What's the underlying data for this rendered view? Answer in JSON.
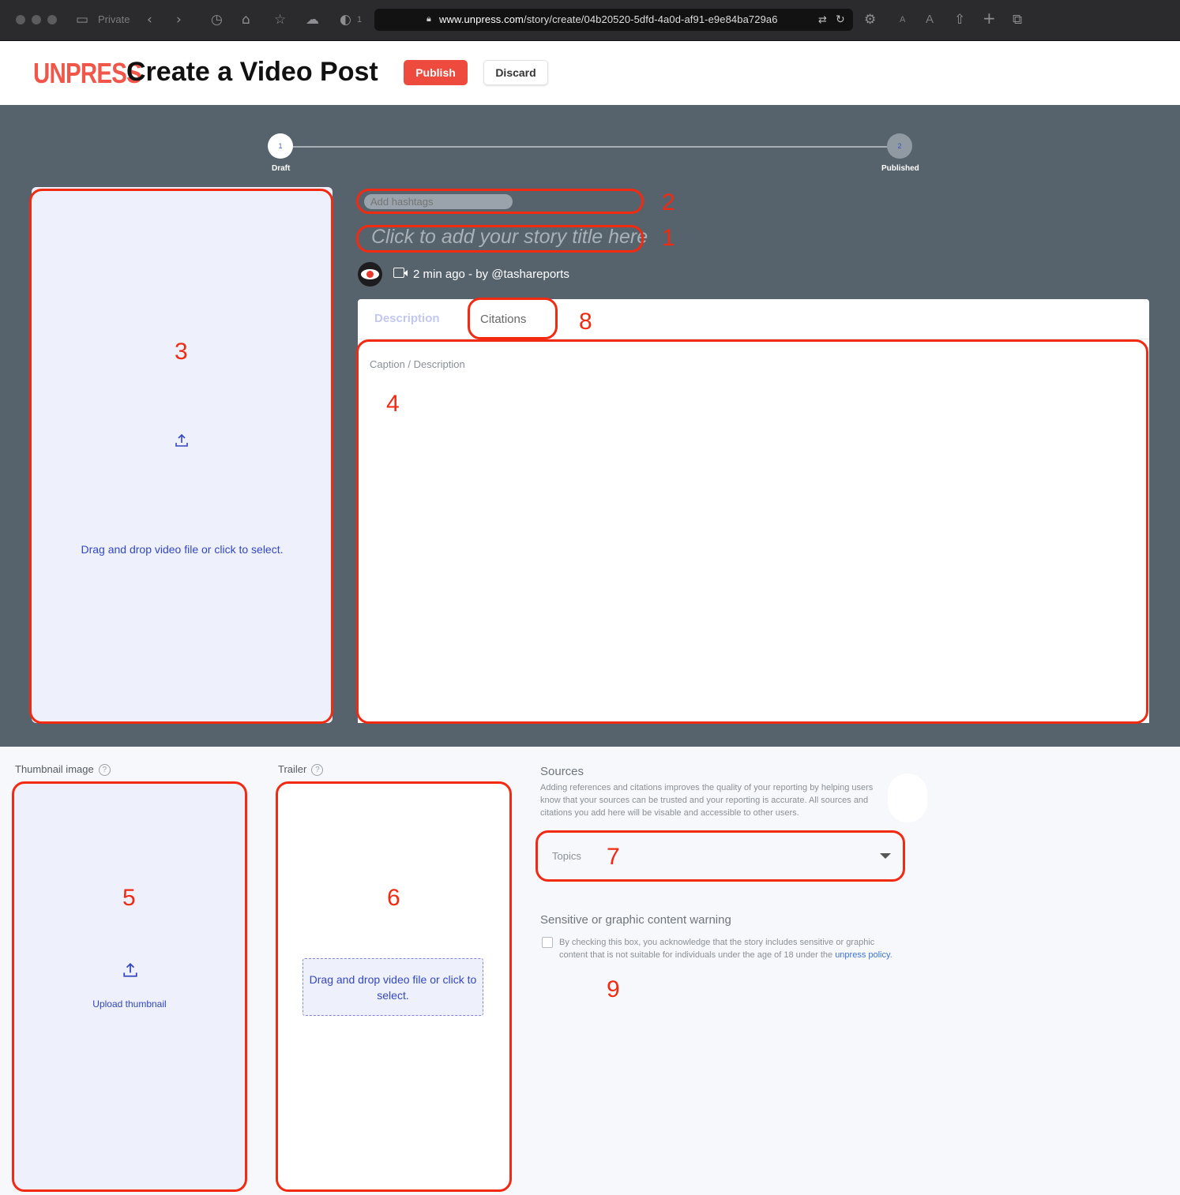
{
  "browser": {
    "private_label": "Private",
    "shield_count": "1",
    "url_domain": "www.unpress.com",
    "url_path": "/story/create/04b20520-5dfd-4a0d-af91-e9e84ba729a6",
    "reader_small": "A",
    "reader_large": "A"
  },
  "header": {
    "logo": "UNPRESS",
    "title": "Create a Video Post",
    "publish_label": "Publish",
    "discard_label": "Discard"
  },
  "stepper": {
    "steps": [
      {
        "number": "1",
        "label": "Draft"
      },
      {
        "number": "2",
        "label": "Published"
      }
    ]
  },
  "editor": {
    "video_drop_text": "Drag and drop video file or click to select.",
    "hashtags_placeholder": "Add hashtags",
    "title_placeholder": "Click to add your story title here",
    "meta": "2 min ago - by @tashareports",
    "tabs": [
      {
        "label": "Description"
      },
      {
        "label": "Citations"
      }
    ],
    "caption_label": "Caption / Description"
  },
  "media": {
    "thumbnail_label": "Thumbnail image",
    "thumbnail_upload": "Upload thumbnail",
    "trailer_label": "Trailer",
    "trailer_drop_text": "Drag and drop video file or click to select.",
    "help_glyph": "?"
  },
  "sources": {
    "title": "Sources",
    "text": "Adding references and citations improves the quality of your reporting by helping users know that your sources can be trusted and your reporting is accurate. All sources and citations you add here will be visable and accessible to other users."
  },
  "topics": {
    "placeholder": "Topics"
  },
  "sensitive": {
    "title": "Sensitive or graphic content warning",
    "text": "By checking this box, you acknowledge that the story includes sensitive or graphic content that is not suitable for individuals under the age of 18 under the",
    "link_text": "unpress policy",
    "period": "."
  },
  "annotations": [
    "1",
    "2",
    "3",
    "4",
    "5",
    "6",
    "7",
    "8",
    "9"
  ],
  "colors": {
    "brand": "#f1564a",
    "annotation": "#f22a12",
    "editor_bg": "#56636d",
    "link": "#3347c2"
  }
}
